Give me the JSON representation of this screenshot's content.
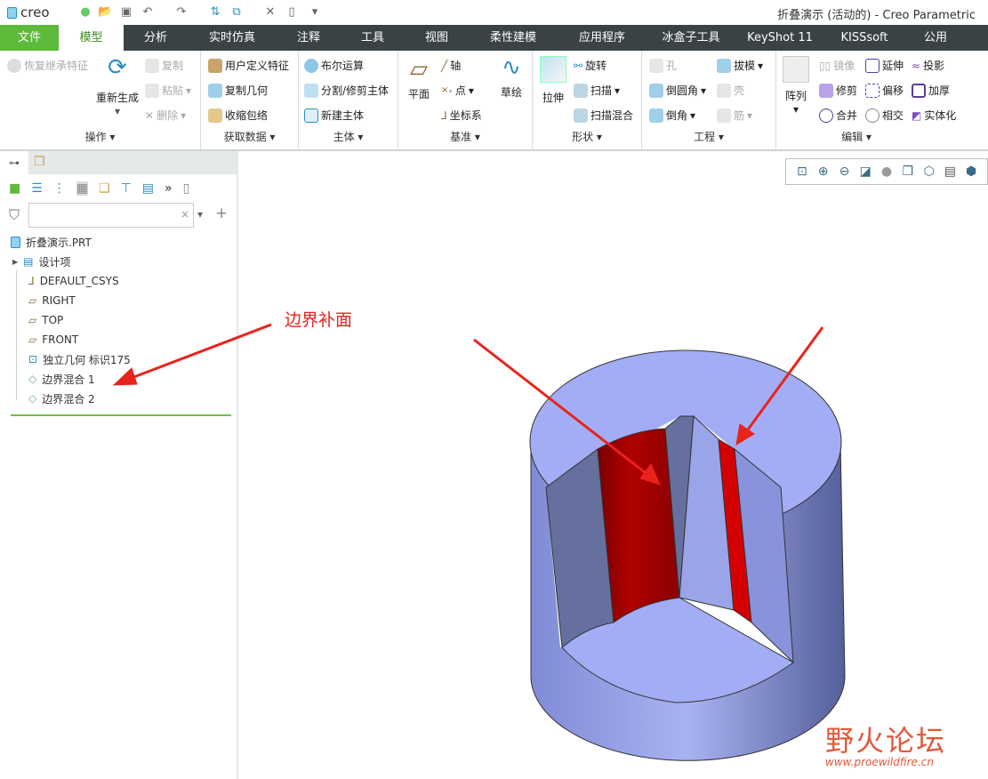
{
  "app": {
    "logo_text": "creo",
    "title": "折叠演示 (活动的) - Creo Parametric"
  },
  "quick_access": [
    "regenerate-icon",
    "open-icon",
    "save-icon",
    "undo-icon",
    "redo-icon",
    "regen-manager-icon",
    "windows-icon",
    "close-icon",
    "new-icon",
    "customize-icon"
  ],
  "tabs": [
    "文件",
    "模型",
    "分析",
    "实时仿真",
    "注释",
    "工具",
    "视图",
    "柔性建模",
    "应用程序",
    "冰盒子工具",
    "KeyShot 11",
    "KISSsoft",
    "公用"
  ],
  "active_tab": "模型",
  "ribbon": {
    "operations": {
      "label": "操作",
      "restore": "恢复继承特征",
      "regenerate": "重新生成",
      "copy": "复制",
      "paste": "粘贴",
      "delete": "删除"
    },
    "get_data": {
      "label": "获取数据",
      "udf": "用户定义特征",
      "copy_geom": "复制几何",
      "shrinkwrap": "收缩包络"
    },
    "body": {
      "label": "主体",
      "boolean": "布尔运算",
      "split": "分割/修剪主体",
      "new_body": "新建主体"
    },
    "datum": {
      "label": "基准",
      "plane": "平面",
      "axis": "轴",
      "point": "点",
      "csys": "坐标系",
      "sketch": "草绘"
    },
    "shapes": {
      "label": "形状",
      "extrude": "拉伸",
      "revolve": "旋转",
      "sweep": "扫描",
      "swept_blend": "扫描混合"
    },
    "engineering": {
      "label": "工程",
      "hole": "孔",
      "draft": "拔模",
      "round": "倒圆角",
      "shell": "壳",
      "chamfer": "倒角",
      "rib": "筋"
    },
    "editing": {
      "label": "编辑",
      "pattern": "阵列",
      "mirror": "镜像",
      "extend": "延伸",
      "project": "投影",
      "trim": "修剪",
      "offset": "偏移",
      "thicken": "加厚",
      "merge": "合并",
      "intersect": "相交",
      "solidify": "实体化"
    }
  },
  "model_tree": {
    "search": {
      "value": "",
      "placeholder": ""
    },
    "root": "折叠演示.PRT",
    "items": [
      {
        "label": "设计项",
        "icon": "design-items-icon"
      },
      {
        "label": "DEFAULT_CSYS",
        "icon": "csys-icon"
      },
      {
        "label": "RIGHT",
        "icon": "datum-plane-icon"
      },
      {
        "label": "TOP",
        "icon": "datum-plane-icon"
      },
      {
        "label": "FRONT",
        "icon": "datum-plane-icon"
      },
      {
        "label": "独立几何 标识175",
        "icon": "independent-geometry-icon"
      },
      {
        "label": "边界混合 1",
        "icon": "boundary-blend-icon"
      },
      {
        "label": "边界混合 2",
        "icon": "boundary-blend-icon"
      }
    ]
  },
  "annotation": {
    "text": "边界补面",
    "color": "#e8231c"
  },
  "watermark": {
    "text": "野火论坛",
    "url": "www.proewildfire.cn"
  },
  "colors": {
    "accent": "#5dba3a",
    "tabbar": "#3b4245",
    "model_face": "#a3adf5",
    "highlight": "#cc0000"
  }
}
